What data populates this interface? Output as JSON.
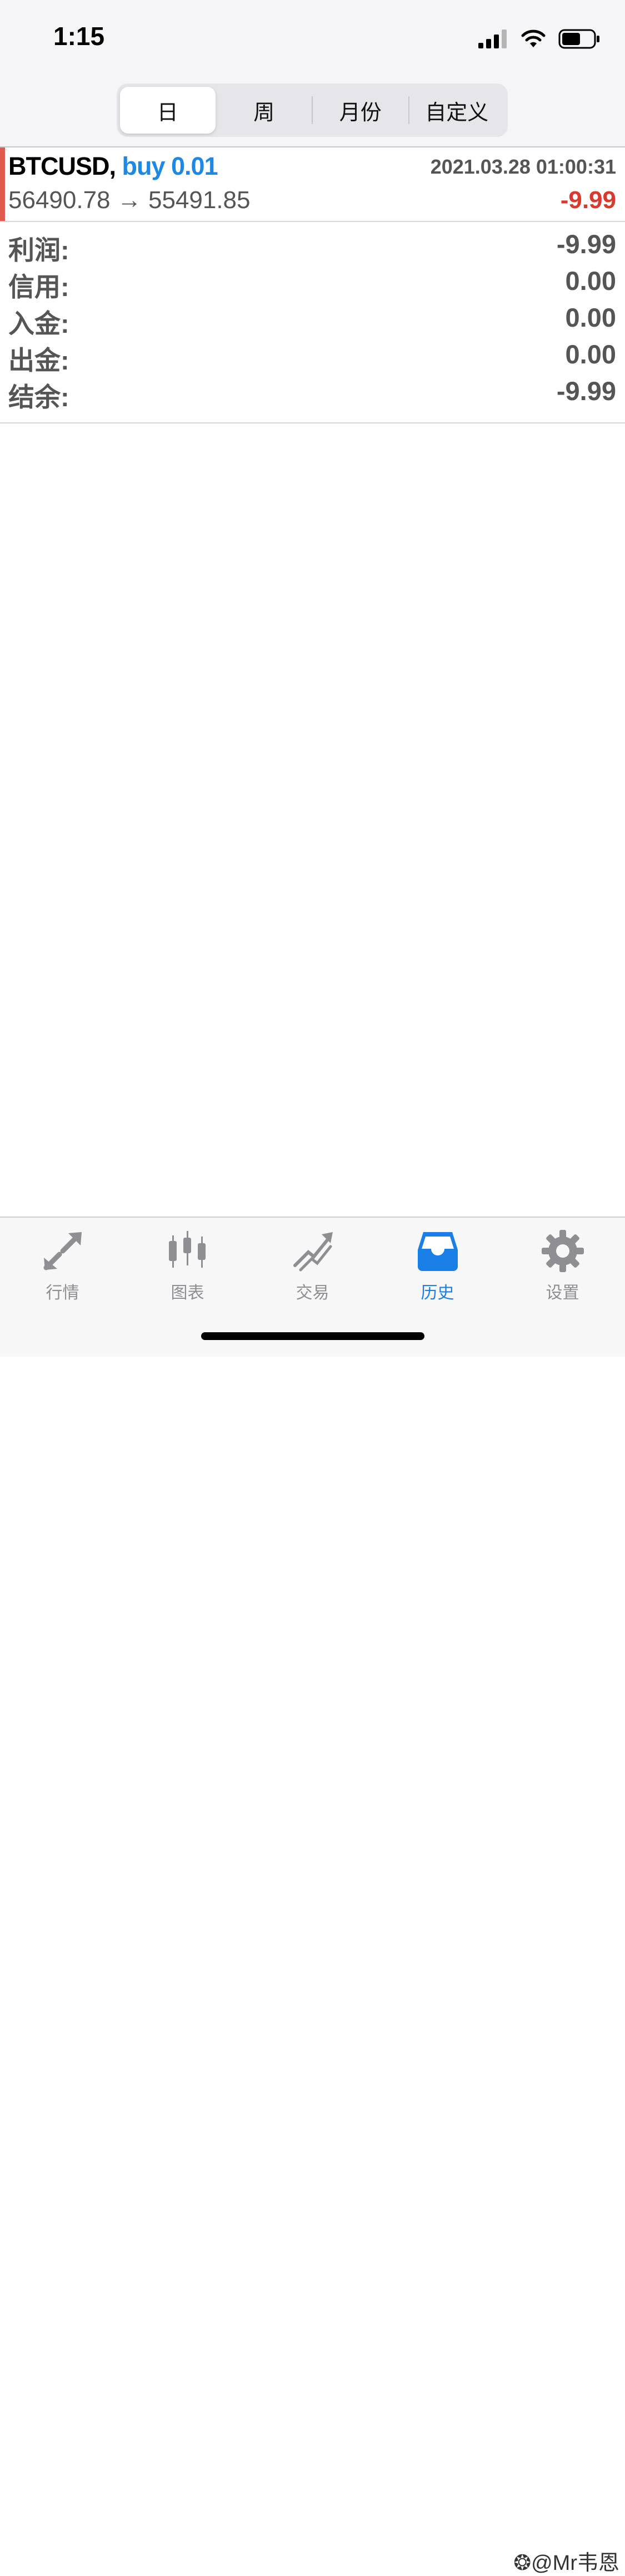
{
  "status_bar": {
    "time": "1:15"
  },
  "segments": [
    {
      "label": "日",
      "active": true
    },
    {
      "label": "周",
      "active": false
    },
    {
      "label": "月份",
      "active": false
    },
    {
      "label": "自定义",
      "active": false
    }
  ],
  "trade": {
    "symbol": "BTCUSD,",
    "side": "buy 0.01",
    "datetime": "2021.03.28 01:00:31",
    "prices": "56490.78 → 55491.85",
    "profit": "-9.99"
  },
  "summary": [
    {
      "label": "利润:",
      "value": "-9.99"
    },
    {
      "label": "信用:",
      "value": "0.00"
    },
    {
      "label": "入金:",
      "value": "0.00"
    },
    {
      "label": "出金:",
      "value": "0.00"
    },
    {
      "label": "结余:",
      "value": "-9.99"
    }
  ],
  "tabs": [
    {
      "label": "行情",
      "icon": "quotes-arrows-icon",
      "active": false
    },
    {
      "label": "图表",
      "icon": "candlestick-chart-icon",
      "active": false
    },
    {
      "label": "交易",
      "icon": "trade-chart-icon",
      "active": false
    },
    {
      "label": "历史",
      "icon": "history-tray-icon",
      "active": true
    },
    {
      "label": "设置",
      "icon": "gear-icon",
      "active": false
    }
  ],
  "watermark": "@Mr韦恩",
  "colors": {
    "accent": "#1a7fe6",
    "loss": "#d93a2e",
    "buy": "#1e88e5",
    "tab_inactive": "#8e8e93",
    "trade_bar": "#e05a4e"
  }
}
